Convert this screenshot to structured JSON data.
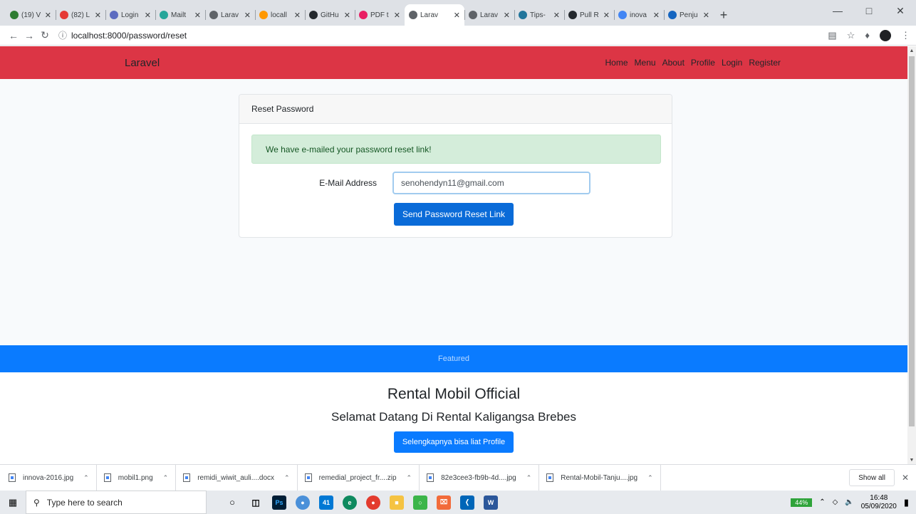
{
  "browser": {
    "tabs": [
      {
        "label": "(19) V",
        "color": "#2e7d32"
      },
      {
        "label": "(82) L",
        "color": "#e53935"
      },
      {
        "label": "Login",
        "color": "#5c6bc0"
      },
      {
        "label": "Mailt",
        "color": "#26a69a"
      },
      {
        "label": "Larav",
        "color": "#5f6368"
      },
      {
        "label": "locall",
        "color": "#ff9800"
      },
      {
        "label": "GitHu",
        "color": "#24292e"
      },
      {
        "label": "PDF t",
        "color": "#e91e63"
      },
      {
        "label": "Larav",
        "color": "#5f6368",
        "active": true
      },
      {
        "label": "Larav",
        "color": "#5f6368"
      },
      {
        "label": "Tips-",
        "color": "#21759b"
      },
      {
        "label": "Pull R",
        "color": "#24292e"
      },
      {
        "label": "inova",
        "color": "#4285f4"
      },
      {
        "label": "Penju",
        "color": "#1565c0"
      }
    ],
    "url": "localhost:8000/password/reset"
  },
  "navbar": {
    "brand": "Laravel",
    "links": [
      "Home",
      "Menu",
      "About",
      "Profile",
      "Login",
      "Register"
    ]
  },
  "card": {
    "header": "Reset Password",
    "alert": "We have e-mailed your password reset link!",
    "email_label": "E-Mail Address",
    "email_value": "senohendyn11@gmail.com",
    "submit": "Send Password Reset Link"
  },
  "featured": "Featured",
  "hero": {
    "title": "Rental Mobil Official",
    "subtitle": "Selamat Datang Di Rental Kaligangsa Brebes",
    "button": "Selengkapnya bisa liat Profile"
  },
  "downloads": {
    "items": [
      "innova-2016.jpg",
      "mobil1.png",
      "remidi_wiwit_auli....docx",
      "remedial_project_fr....zip",
      "82e3cee3-fb9b-4d....jpg",
      "Rental-Mobil-Tanju....jpg"
    ],
    "show_all": "Show all"
  },
  "taskbar": {
    "search_placeholder": "Type here to search",
    "battery": "44%",
    "time": "16:48",
    "date": "05/09/2020",
    "mail_badge": "41"
  }
}
